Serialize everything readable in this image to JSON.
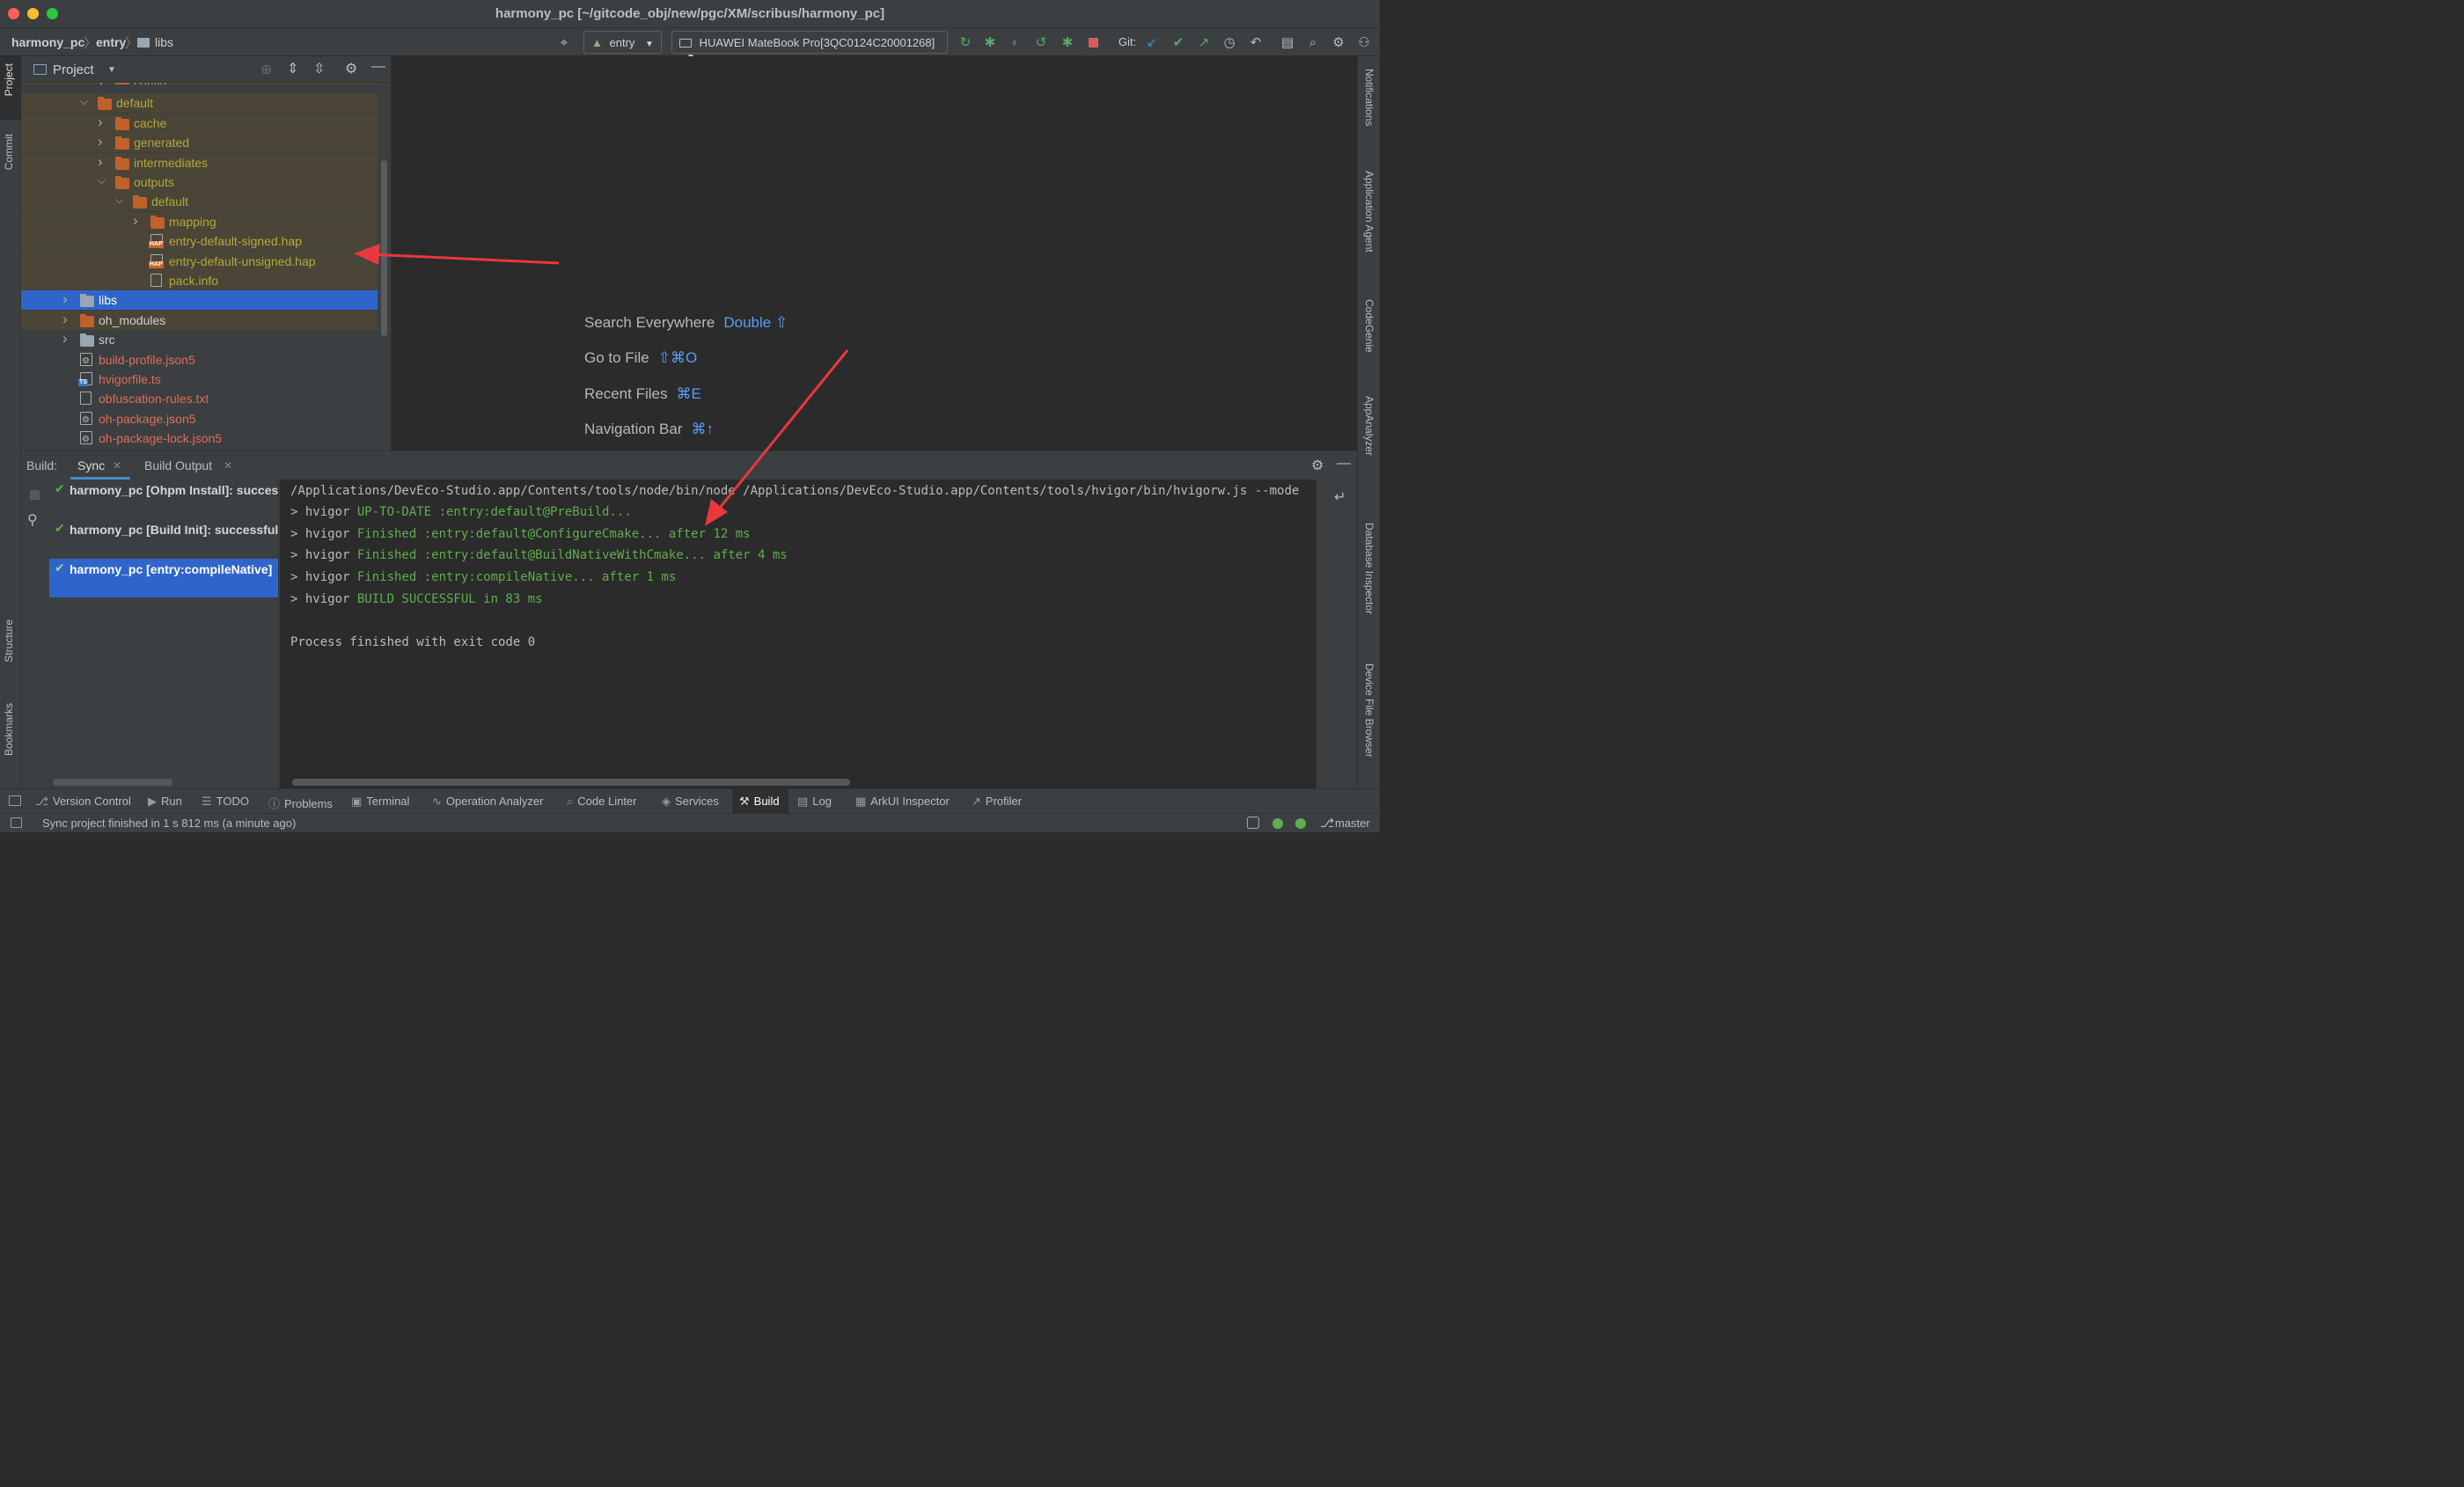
{
  "window": {
    "title": "harmony_pc [~/gitcode_obj/new/pgc/XM/scribus/harmony_pc]"
  },
  "breadcrumb": [
    "harmony_pc",
    "entry",
    "libs"
  ],
  "toolbar": {
    "run_config": "entry",
    "device": "HUAWEI MateBook Pro[3QC0124C20001268]",
    "git_label": "Git:"
  },
  "left_strip": {
    "project": "Project",
    "commit": "Commit",
    "structure": "Structure",
    "bookmarks": "Bookmarks"
  },
  "right_strip": [
    "Notifications",
    "Application Agent",
    "CodeGenie",
    "AppAnalyzer",
    "Database Inspector",
    "Device File Browser"
  ],
  "project_panel": {
    "title": "Project",
    "tree": [
      {
        "label": "config",
        "type": "folder",
        "depth": 4,
        "expanded": false,
        "clipped": true
      },
      {
        "label": "default",
        "type": "folder",
        "depth": 3,
        "expanded": true
      },
      {
        "label": "cache",
        "type": "folder",
        "depth": 4,
        "expanded": false
      },
      {
        "label": "generated",
        "type": "folder",
        "depth": 4,
        "expanded": false
      },
      {
        "label": "intermediates",
        "type": "folder",
        "depth": 4,
        "expanded": false
      },
      {
        "label": "outputs",
        "type": "folder",
        "depth": 4,
        "expanded": true
      },
      {
        "label": "default",
        "type": "folder",
        "depth": 5,
        "expanded": true
      },
      {
        "label": "mapping",
        "type": "folder",
        "depth": 6,
        "expanded": false
      },
      {
        "label": "entry-default-signed.hap",
        "type": "hap",
        "depth": 6
      },
      {
        "label": "entry-default-unsigned.hap",
        "type": "hap",
        "depth": 6
      },
      {
        "label": "pack.info",
        "type": "file",
        "depth": 6
      },
      {
        "label": "libs",
        "type": "folder-gray",
        "depth": 2,
        "expanded": false,
        "selected": true
      },
      {
        "label": "oh_modules",
        "type": "folder",
        "depth": 2,
        "expanded": false
      },
      {
        "label": "src",
        "type": "folder-gray",
        "depth": 2,
        "expanded": false
      },
      {
        "label": "build-profile.json5",
        "type": "config",
        "depth": 2
      },
      {
        "label": "hvigorfile.ts",
        "type": "ts",
        "depth": 2
      },
      {
        "label": "obfuscation-rules.txt",
        "type": "file",
        "depth": 2
      },
      {
        "label": "oh-package.json5",
        "type": "config",
        "depth": 2
      },
      {
        "label": "oh-package-lock.json5",
        "type": "config",
        "depth": 2
      }
    ]
  },
  "editor_hints": [
    {
      "label": "Search Everywhere",
      "key": "Double ⇧"
    },
    {
      "label": "Go to File",
      "key": "⇧⌘O"
    },
    {
      "label": "Recent Files",
      "key": "⌘E"
    },
    {
      "label": "Navigation Bar",
      "key": "⌘↑"
    }
  ],
  "build_panel": {
    "label": "Build:",
    "tabs": [
      "Sync",
      "Build Output"
    ],
    "tree": [
      {
        "text": "harmony_pc [Ohpm Install]: successful"
      },
      {
        "text": "harmony_pc [Build Init]: successful"
      },
      {
        "text": "harmony_pc [entry:compileNative]",
        "selected": true
      }
    ],
    "console": {
      "command": "/Applications/DevEco-Studio.app/Contents/tools/node/bin/node /Applications/DevEco-Studio.app/Contents/tools/hvigor/bin/hvigorw.js --mode",
      "lines": [
        {
          "prefix": "> hvigor ",
          "text": "UP-TO-DATE :entry:default@PreBuild..."
        },
        {
          "prefix": "> hvigor ",
          "text": "Finished :entry:default@ConfigureCmake... after 12 ms"
        },
        {
          "prefix": "> hvigor ",
          "text": "Finished :entry:default@BuildNativeWithCmake... after 4 ms"
        },
        {
          "prefix": "> hvigor ",
          "text": "Finished :entry:compileNative... after 1 ms"
        },
        {
          "prefix": "> hvigor ",
          "text": "BUILD SUCCESSFUL in 83 ms"
        }
      ],
      "exit": "Process finished with exit code 0"
    }
  },
  "bottom_tabs": [
    {
      "label": "Version Control",
      "icon": "⎇"
    },
    {
      "label": "Run",
      "icon": "▶"
    },
    {
      "label": "TODO",
      "icon": "☰"
    },
    {
      "label": "Problems",
      "icon": "ⓘ"
    },
    {
      "label": "Terminal",
      "icon": "▣"
    },
    {
      "label": "Operation Analyzer",
      "icon": "∿"
    },
    {
      "label": "Code Linter",
      "icon": "⌕"
    },
    {
      "label": "Services",
      "icon": "◈"
    },
    {
      "label": "Build",
      "icon": "⚒",
      "active": true
    },
    {
      "label": "Log",
      "icon": "▤"
    },
    {
      "label": "ArkUI Inspector",
      "icon": "▦"
    },
    {
      "label": "Profiler",
      "icon": "↗"
    }
  ],
  "status": {
    "message": "Sync project finished in 1 s 812 ms (a minute ago)",
    "branch": "master"
  },
  "colors": {
    "accent": "#2f65ca",
    "success": "#5fae4d",
    "folder": "#c0612c",
    "file_text_excluded": "#b4a83c",
    "file_text_modified": "#e06c57",
    "hint_key": "#589df6",
    "annotation": "#e8383d"
  }
}
